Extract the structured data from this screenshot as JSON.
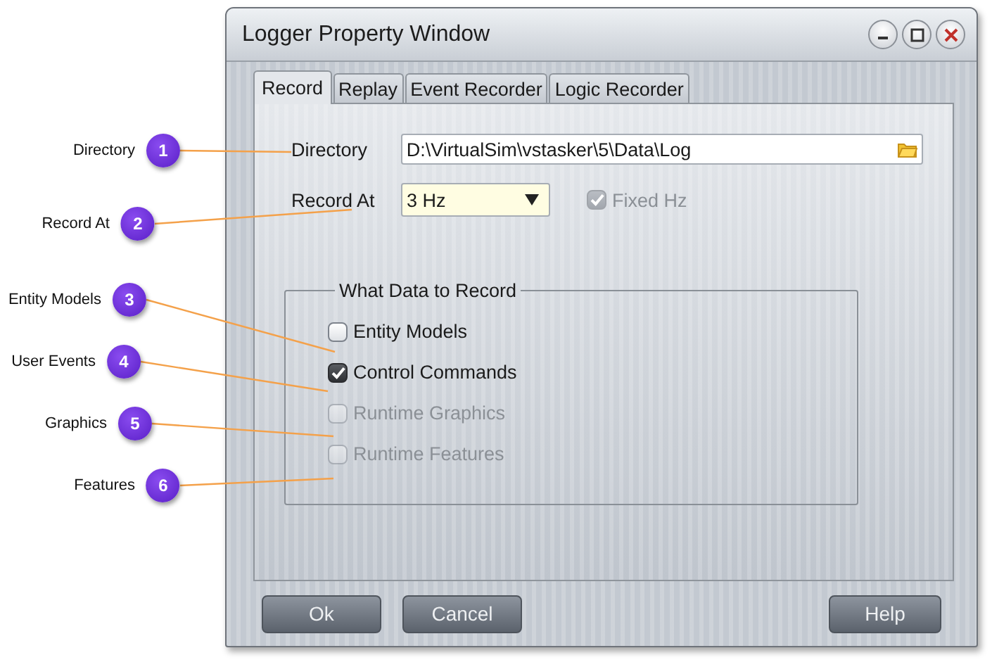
{
  "window": {
    "title": "Logger Property Window"
  },
  "tabs": [
    {
      "label": "Record",
      "selected": true
    },
    {
      "label": "Replay",
      "selected": false
    },
    {
      "label": "Event Recorder",
      "selected": false
    },
    {
      "label": "Logic Recorder",
      "selected": false
    }
  ],
  "directory": {
    "label": "Directory",
    "value": "D:\\VirtualSim\\vstasker\\5\\Data\\Log"
  },
  "record_at": {
    "label": "Record At",
    "value": "3 Hz"
  },
  "fixed_hz": {
    "label": "Fixed Hz",
    "checked": true,
    "disabled": true
  },
  "group": {
    "title": "What Data to Record",
    "items": [
      {
        "label": "Entity Models",
        "checked": false,
        "disabled": false
      },
      {
        "label": "Control Commands",
        "checked": true,
        "disabled": false
      },
      {
        "label": "Runtime Graphics",
        "checked": false,
        "disabled": true
      },
      {
        "label": "Runtime Features",
        "checked": false,
        "disabled": true
      }
    ]
  },
  "buttons": [
    "Ok",
    "Cancel",
    "Help"
  ],
  "callouts": [
    {
      "number": "1",
      "label": "Directory"
    },
    {
      "number": "2",
      "label": "Record At"
    },
    {
      "number": "3",
      "label": "Entity Models"
    },
    {
      "number": "4",
      "label": "User Events"
    },
    {
      "number": "5",
      "label": "Graphics"
    },
    {
      "number": "6",
      "label": "Features"
    }
  ]
}
